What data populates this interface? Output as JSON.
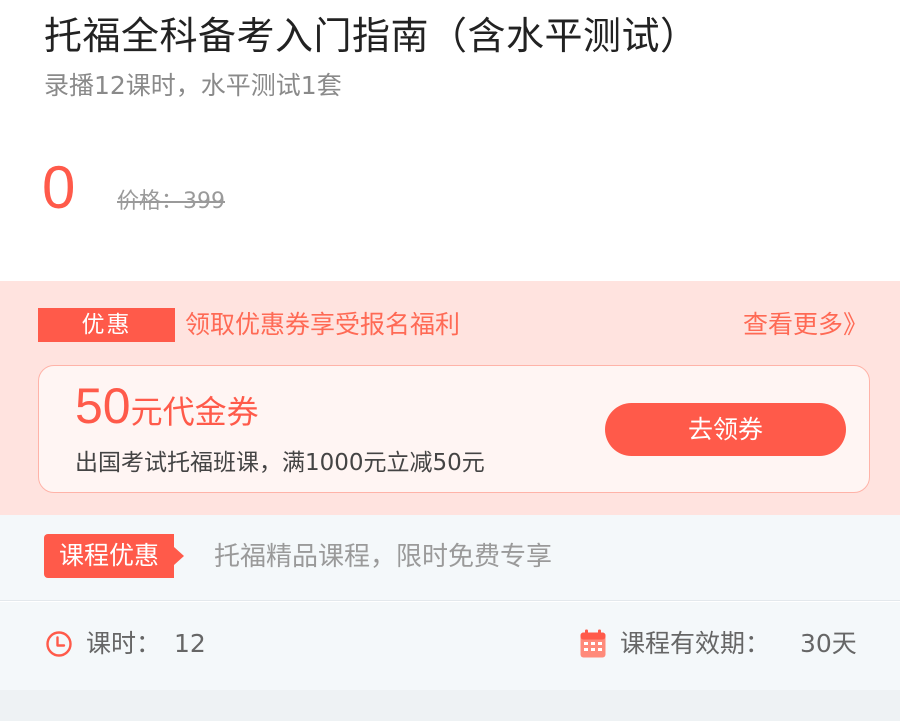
{
  "course": {
    "title": "托福全科备考入门指南（含水平测试）",
    "subtitle": "录播12课时，水平测试1套",
    "price_current": "0",
    "price_original": "价格：399"
  },
  "promo": {
    "tag": "优惠",
    "text": "领取优惠券享受报名福利",
    "more_link": "查看更多》",
    "coupon": {
      "amount": "50",
      "unit": "元代金券",
      "description": "出国考试托福班课，满1000元立减50元",
      "button": "去领券"
    }
  },
  "offer": {
    "tag": "课程优惠",
    "text": "托福精品课程，限时免费专享"
  },
  "meta": {
    "hours_label": "课时：",
    "hours_value": "12",
    "validity_label": "课程有效期：",
    "validity_value": "30天"
  },
  "icons": {
    "clock": "clock-icon",
    "calendar": "calendar-icon"
  },
  "colors": {
    "accent": "#ff5a4a",
    "promo_bg": "#ffe3df",
    "coupon_bg": "#fff5f3",
    "muted_bg": "#f4f8fa"
  }
}
